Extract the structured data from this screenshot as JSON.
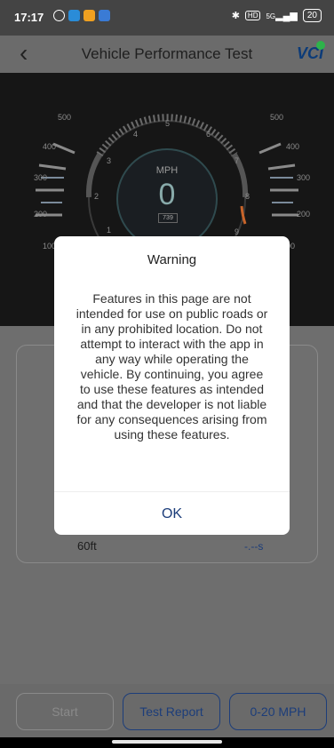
{
  "status_bar": {
    "time": "17:17",
    "network": "5G",
    "battery": "20"
  },
  "header": {
    "title": "Vehicle Performance Test",
    "back_icon": "chevron-left-icon",
    "vci_label": "VCI"
  },
  "gauge": {
    "unit": "MPH",
    "speed": "0",
    "rpm_readout": "739",
    "speed_ticks": [
      "1",
      "2",
      "3",
      "4",
      "5",
      "6",
      "7",
      "8",
      "9"
    ],
    "side_ticks_left": [
      "500",
      "400",
      "300",
      "200",
      "100"
    ],
    "side_ticks_right": [
      "500",
      "400",
      "300",
      "200",
      "00"
    ]
  },
  "results": {
    "row_label": "60ft",
    "row_value": "-.--s"
  },
  "buttons": {
    "start": "Start",
    "test_report": "Test Report",
    "mode": "0-20 MPH"
  },
  "dialog": {
    "title": "Warning",
    "body": "Features in this page are not intended for use on public roads or in any prohibited location. Do not attempt to interact with the app in any way while operating the vehicle.  By continuing, you agree to use these features as intended and that the developer is not liable for any consequences arising from using these features.",
    "ok_label": "OK"
  },
  "colors": {
    "accent": "#1c3d7a",
    "vci_dot": "#2eb34a",
    "overlay_gray": "#6e6e6e"
  }
}
